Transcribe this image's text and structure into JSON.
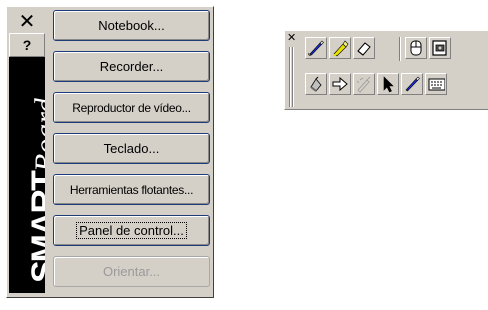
{
  "menu": {
    "close_glyph": "✕",
    "help_glyph": "?",
    "brand": {
      "smart": "SMART",
      "board": "Board"
    },
    "items": [
      {
        "label": "Notebook...",
        "enabled": true
      },
      {
        "label": "Recorder...",
        "enabled": true
      },
      {
        "label": "Reproductor de vídeo...",
        "enabled": true
      },
      {
        "label": "Teclado...",
        "enabled": true
      },
      {
        "label": "Herramientas flotantes...",
        "enabled": true
      },
      {
        "label": "Panel de control...",
        "enabled": true,
        "focused": true
      },
      {
        "label": "Orientar...",
        "enabled": false
      }
    ]
  },
  "toolbar": {
    "close_glyph": "✕",
    "row1_tools": [
      "pen-icon",
      "highlighter-icon",
      "eraser-icon",
      "mouse-icon",
      "screen-capture-icon"
    ],
    "row2_tools": [
      "magnifier-icon",
      "right-arrow-icon",
      "disabled-pen-icon",
      "cursor-icon",
      "pen-icon",
      "keyboard-icon"
    ],
    "colors": {
      "pen": "#1a2ee0",
      "highlighter": "#e8e000",
      "cursor": "#000000",
      "disabled": "#9a9a9a"
    }
  }
}
